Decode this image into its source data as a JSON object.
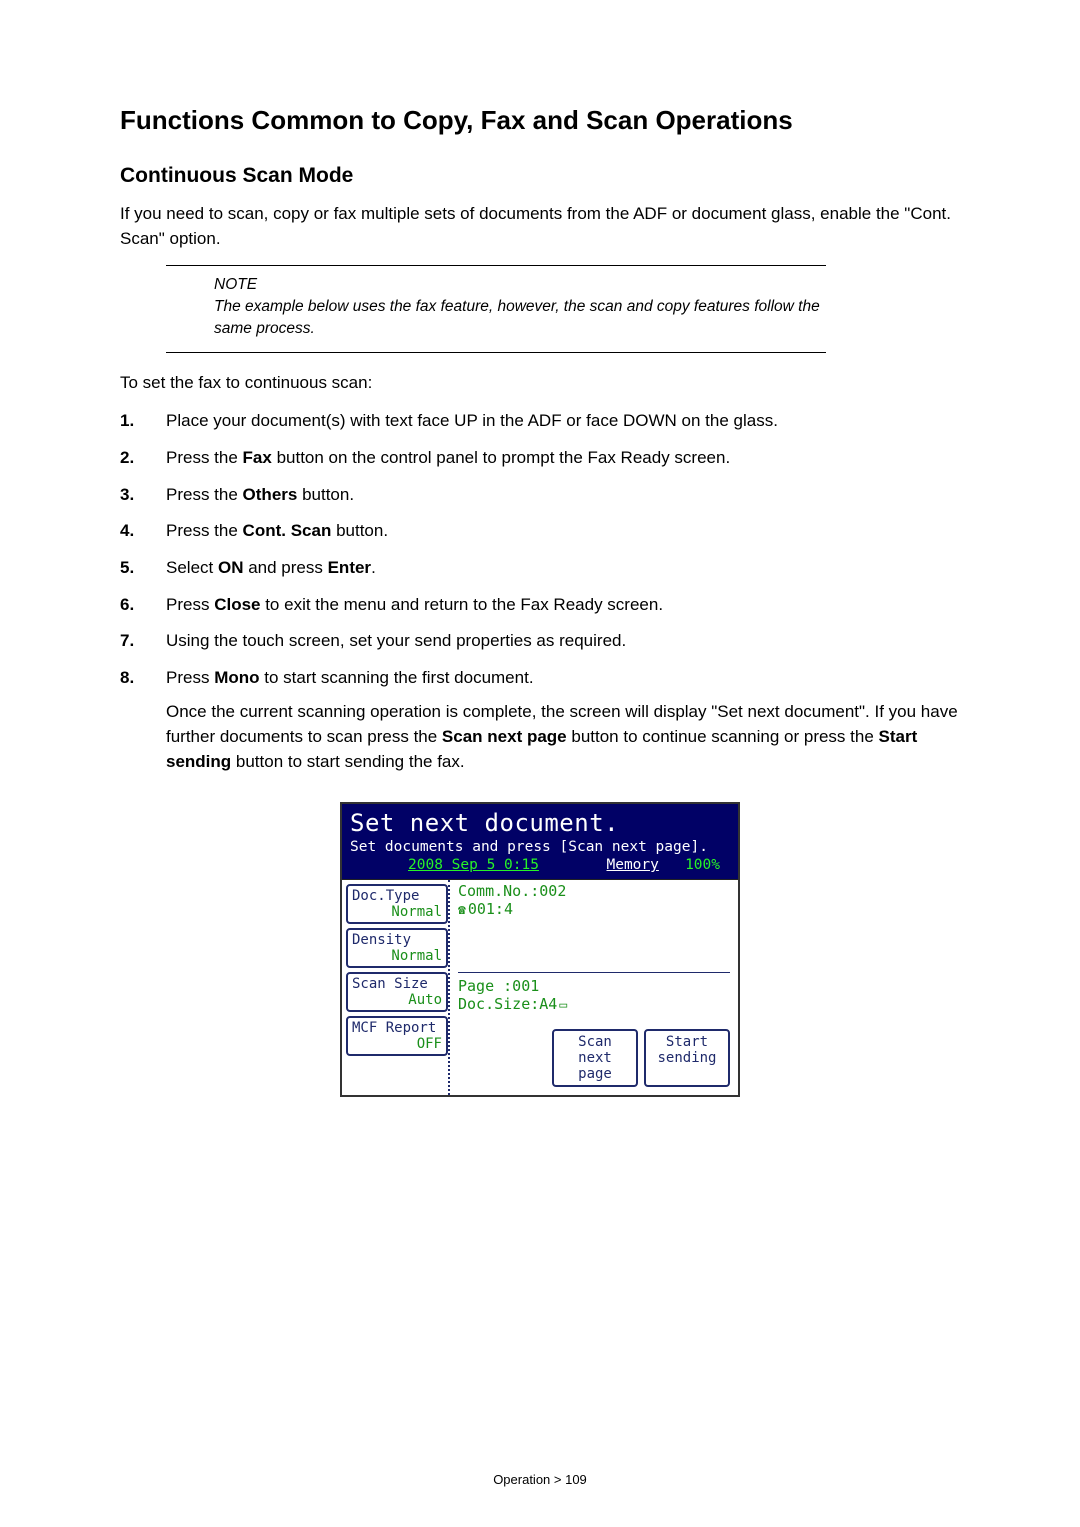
{
  "section_title": "Functions Common to Copy, Fax and Scan Operations",
  "sub_title": "Continuous Scan Mode",
  "intro": "If you need to scan, copy or fax multiple sets of documents from the ADF or document glass, enable the \"Cont. Scan\" option.",
  "note": {
    "label": "NOTE",
    "text": "The example below uses the fax feature, however, the scan and copy features follow the same process."
  },
  "lead_in": "To set the fax to continuous scan:",
  "steps": {
    "s1": "Place your document(s) with text face UP in the ADF or face DOWN on the glass.",
    "s2_a": "Press the ",
    "s2_b": "Fax",
    "s2_c": " button on the control panel to prompt the Fax Ready screen.",
    "s3_a": "Press the ",
    "s3_b": "Others",
    "s3_c": " button.",
    "s4_a": "Press the ",
    "s4_b": "Cont. Scan",
    "s4_c": " button.",
    "s5_a": "Select ",
    "s5_b": "ON",
    "s5_c": " and press ",
    "s5_d": "Enter",
    "s5_e": ".",
    "s6_a": "Press ",
    "s6_b": "Close",
    "s6_c": " to exit the menu and return to the Fax Ready screen.",
    "s7": "Using the touch screen, set your send properties as required.",
    "s8_a": "Press ",
    "s8_b": "Mono",
    "s8_c": " to start scanning the first document.",
    "follow_a": "Once the current scanning operation is complete, the screen will display \"Set next document\". If you have further documents to scan press the ",
    "follow_b": "Scan next page",
    "follow_c": " button to continue scanning or press the ",
    "follow_d": "Start sending",
    "follow_e": " button to start sending the fax."
  },
  "lcd": {
    "title": "Set next document.",
    "subtitle": "Set documents and press [Scan next page].",
    "datetime": "2008 Sep  5  0:15",
    "memory_label": "Memory",
    "memory_value": "100%",
    "comm_no": "Comm.No.:002",
    "dialed": "001:4",
    "left": [
      {
        "top": "Doc.Type",
        "bot": "Normal"
      },
      {
        "top": "Density",
        "bot": "Normal"
      },
      {
        "top": "Scan Size",
        "bot": "Auto"
      },
      {
        "top": "MCF Report",
        "bot": "OFF"
      }
    ],
    "page": "Page :001",
    "docsize": "Doc.Size:A4",
    "actions": {
      "scan_line1": "Scan",
      "scan_line2": "next page",
      "start_line1": "Start",
      "start_line2": "sending"
    }
  },
  "footer": "Operation > 109"
}
